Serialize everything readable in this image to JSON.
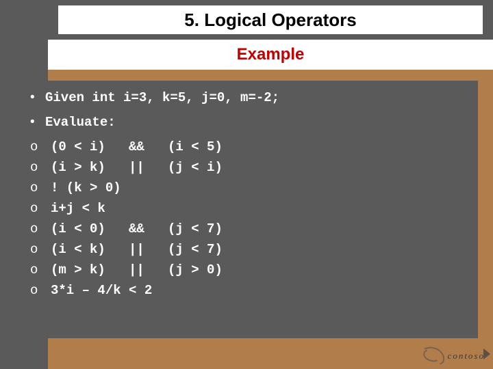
{
  "title": "5. Logical Operators",
  "subtitle": "Example",
  "bullets": {
    "given": "Given int i=3, k=5, j=0, m=-2;",
    "evaluate": "Evaluate:"
  },
  "items": [
    "(0 < i)   &&   (i < 5)",
    "(i > k)   ||   (j < i)",
    "! (k > 0)",
    "i+j < k",
    "(i < 0)   &&   (j < 7)",
    "(i < k)   ||   (j < 7)",
    "(m > k)   ||   (j > 0)",
    "3*i – 4/k < 2"
  ],
  "logo": "contoso"
}
